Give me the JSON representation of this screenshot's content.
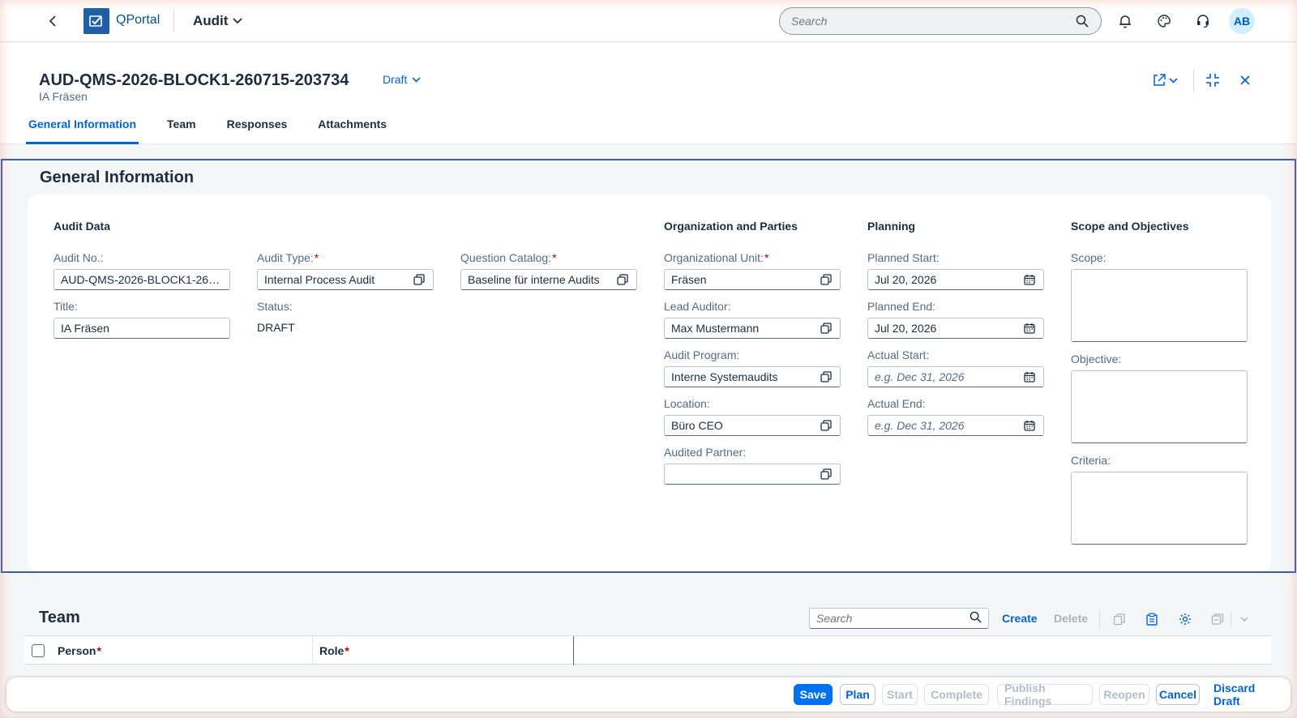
{
  "shell": {
    "brand": "QPortal",
    "product": "Audit",
    "search_placeholder": "Search",
    "avatar_initials": "AB"
  },
  "header": {
    "title": "AUD-QMS-2026-BLOCK1-260715-203734",
    "subtitle": "IA Fräsen",
    "status": "Draft"
  },
  "tabs": [
    "General Information",
    "Team",
    "Responses",
    "Attachments"
  ],
  "general": {
    "section_title": "General Information",
    "audit_data": {
      "title": "Audit Data",
      "audit_no_label": "Audit No.:",
      "audit_no_value": "AUD-QMS-2026-BLOCK1-260715-203734",
      "title_label": "Title:",
      "title_value": "IA Fräsen",
      "audit_type_label": "Audit Type:",
      "audit_type_value": "Internal Process Audit",
      "status_label": "Status:",
      "status_value": "DRAFT",
      "question_catalog_label": "Question Catalog:",
      "question_catalog_value": "Baseline für interne Audits"
    },
    "organization": {
      "title": "Organization and Parties",
      "org_unit_label": "Organizational Unit:",
      "org_unit_value": "Fräsen",
      "lead_auditor_label": "Lead Auditor:",
      "lead_auditor_value": "Max Mustermann",
      "audit_program_label": "Audit Program:",
      "audit_program_value": "Interne Systemaudits",
      "location_label": "Location:",
      "location_value": "Büro CEO",
      "audited_partner_label": "Audited Partner:",
      "audited_partner_value": ""
    },
    "planning": {
      "title": "Planning",
      "planned_start_label": "Planned Start:",
      "planned_start_value": "Jul 20, 2026",
      "planned_end_label": "Planned End:",
      "planned_end_value": "Jul 20, 2026",
      "actual_start_label": "Actual Start:",
      "actual_start_placeholder": "e.g. Dec 31, 2026",
      "actual_end_label": "Actual End:",
      "actual_end_placeholder": "e.g. Dec 31, 2026"
    },
    "scope": {
      "title": "Scope and Objectives",
      "scope_label": "Scope:",
      "objective_label": "Objective:",
      "criteria_label": "Criteria:"
    }
  },
  "team": {
    "section_title": "Team",
    "search_placeholder": "Search",
    "create_label": "Create",
    "delete_label": "Delete",
    "columns": [
      "Person",
      "Role"
    ]
  },
  "footer": {
    "save": "Save",
    "plan": "Plan",
    "start": "Start",
    "complete": "Complete",
    "publish_findings": "Publish Findings",
    "reopen": "Reopen",
    "cancel": "Cancel",
    "discard_draft": "Discard Draft"
  },
  "colors": {
    "accent": "#0064d9",
    "primary_button": "#0070f2",
    "required": "#aa0808",
    "focus_border": "#3d5ca8"
  }
}
